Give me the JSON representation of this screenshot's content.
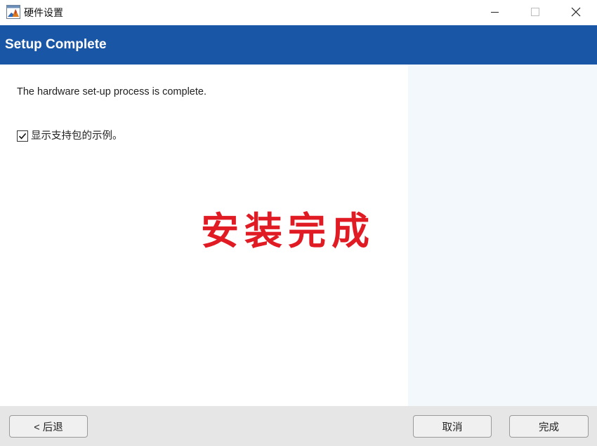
{
  "window": {
    "title": "硬件设置",
    "app_icon": "matlab-logo-icon",
    "controls": {
      "minimize_icon": "minimize-icon",
      "maximize_icon": "maximize-icon",
      "close_icon": "close-icon"
    }
  },
  "header": {
    "title": "Setup Complete",
    "background": "#1a56a6"
  },
  "main": {
    "message": "The hardware set-up process is complete.",
    "checkbox": {
      "label": "显示支持包的示例。",
      "checked": true
    },
    "overlay_text": "安装完成",
    "overlay_color": "#e01b24"
  },
  "side_panel": {
    "background": "#f3f8fc"
  },
  "footer": {
    "back_label": "< 后退",
    "cancel_label": "取消",
    "finish_label": "完成"
  }
}
